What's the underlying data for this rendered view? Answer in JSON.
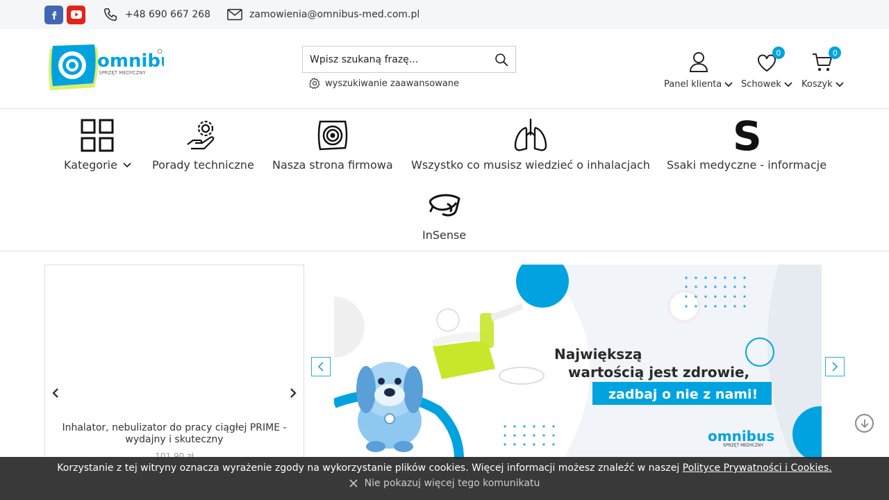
{
  "topbar": {
    "phone": "+48 690 667 268",
    "email": "zamowienia@omnibus-med.com.pl"
  },
  "header": {
    "logo_text": "omnibus",
    "logo_sub": "SPRZĘT MEDYCZNY",
    "search_placeholder": "Wpisz szukaną frazę...",
    "advanced_search": "wyszukiwanie zaawansowane",
    "client_panel": "Panel klienta",
    "wishlist": "Schowek",
    "wishlist_count": "0",
    "cart": "Koszyk",
    "cart_count": "0"
  },
  "nav": {
    "items": [
      {
        "label": "Kategorie"
      },
      {
        "label": "Porady techniczne"
      },
      {
        "label": "Nasza strona firmowa"
      },
      {
        "label": "Wszystko co musisz wiedzieć o inhalacjach"
      },
      {
        "label": "Ssaki medyczne - informacje"
      },
      {
        "label": "InSense"
      }
    ]
  },
  "product": {
    "title": "Inhalator, nebulizator do pracy ciągłej PRIME - wydajny i skuteczny",
    "price": "101,90 zł"
  },
  "banner": {
    "line1": "Największą",
    "line2": "wartością jest zdrowie,",
    "line3": "zadbaj o nie z nami!",
    "brand": "omnibus",
    "brand_sub": "SPRZĘT MEDYCZNY"
  },
  "cookie": {
    "message": "Korzystanie z tej witryny oznacza wyrażenie zgody na wykorzystanie plików cookies. Więcej informacji możesz znaleźć w naszej",
    "link": "Polityce Prywatności i Cookies.",
    "dismiss": "Nie pokazuj więcej tego komunikatu"
  },
  "colors": {
    "accent": "#00a3e0",
    "lime": "#c8e62a",
    "facebook": "#4267b2",
    "youtube": "#e62117"
  }
}
